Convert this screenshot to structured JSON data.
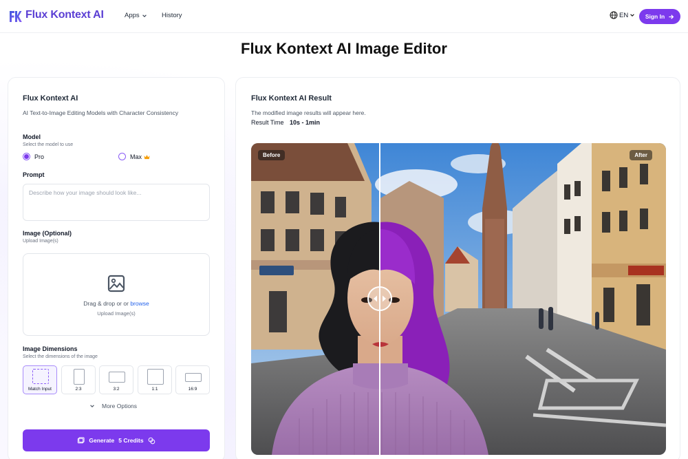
{
  "header": {
    "logo_mark": "FK",
    "brand": "Flux Kontext AI",
    "nav": {
      "apps": "Apps",
      "history": "History"
    },
    "language": "EN",
    "signin": "Sign In"
  },
  "page_title": "Flux Kontext AI Image Editor",
  "editor": {
    "title": "Flux Kontext AI",
    "subtitle": "AI Text-to-Image Editing Models with Character Consistency",
    "model": {
      "label": "Model",
      "hint": "Select the model to use",
      "options": [
        {
          "label": "Pro",
          "selected": true
        },
        {
          "label": "Max",
          "badge": "crown-icon",
          "selected": false
        }
      ]
    },
    "prompt": {
      "label": "Prompt",
      "value": "",
      "placeholder": "Describe how your image should look like..."
    },
    "image": {
      "label": "Image (Optional)",
      "hint": "Upload Image(s)",
      "drop_text": "Drag & drop or or",
      "browse": "browse",
      "drop_hint": "Upload Image(s)"
    },
    "dimensions": {
      "label": "Image Dimensions",
      "hint": "Select the dimensions of the image",
      "options": [
        "Match Input",
        "2:3",
        "3:2",
        "1:1",
        "16:9"
      ],
      "selected": "Match Input"
    },
    "more_options": "More Options",
    "generate": {
      "label": "Generate",
      "credits": "5 Credits"
    }
  },
  "result": {
    "title": "Flux Kontext AI Result",
    "subtitle": "The modified image results will appear here.",
    "time_label": "Result Time",
    "time_value": "10s - 1min",
    "before_label": "Before",
    "after_label": "After",
    "slider_position": 0.31
  },
  "colors": {
    "accent": "#7c3aed",
    "brand_text": "#5b3fd4",
    "link": "#2563eb"
  }
}
